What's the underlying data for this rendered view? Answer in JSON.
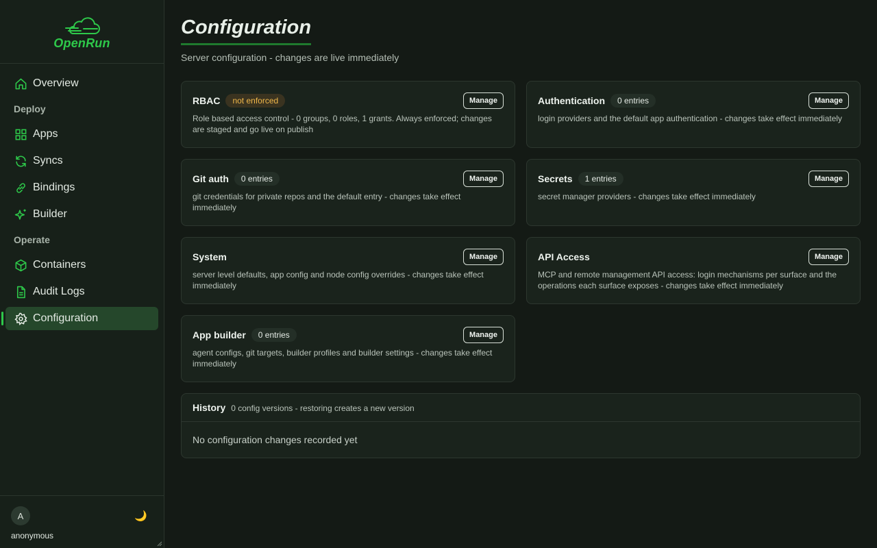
{
  "app": {
    "name": "OpenRun"
  },
  "sidebar": {
    "items": [
      {
        "label": "Overview"
      },
      {
        "section": "Deploy"
      },
      {
        "label": "Apps"
      },
      {
        "label": "Syncs"
      },
      {
        "label": "Bindings"
      },
      {
        "label": "Builder"
      },
      {
        "section": "Operate"
      },
      {
        "label": "Containers"
      },
      {
        "label": "Audit Logs"
      },
      {
        "label": "Configuration",
        "active": true
      }
    ],
    "user": {
      "initial": "A",
      "name": "anonymous"
    },
    "theme_icon": "🌙"
  },
  "page": {
    "title": "Configuration",
    "subtitle": "Server configuration - changes are live immediately"
  },
  "cards": [
    {
      "title": "RBAC",
      "badge": "not enforced",
      "button": "Manage",
      "desc": "Role based access control - 0 groups, 0 roles, 1 grants. Always enforced; changes are staged and go live on publish"
    },
    {
      "title": "Authentication",
      "badge": "0 entries",
      "button": "Manage",
      "desc": "login providers and the default app authentication - changes take effect immediately"
    },
    {
      "title": "Git auth",
      "badge": "0 entries",
      "button": "Manage",
      "desc": "git credentials for private repos and the default entry - changes take effect immediately"
    },
    {
      "title": "Secrets",
      "badge": "1 entries",
      "button": "Manage",
      "desc": "secret manager providers - changes take effect immediately"
    },
    {
      "title": "System",
      "button": "Manage",
      "desc": "server level defaults, app config and node config overrides - changes take effect immediately"
    },
    {
      "title": "API Access",
      "button": "Manage",
      "desc": "MCP and remote management API access: login mechanisms per surface and the operations each surface exposes - changes take effect immediately"
    },
    {
      "title": "App builder",
      "badge": "0 entries",
      "button": "Manage",
      "desc": "agent configs, git targets, builder profiles and builder settings - changes take effect immediately"
    }
  ],
  "history": {
    "title": "History",
    "subtitle": "0 config versions - restoring creates a new version",
    "empty": "No configuration changes recorded yet"
  },
  "colors": {
    "accent": "#2ec94a",
    "active_bg": "#25472b",
    "warn": "#f0b84a"
  }
}
